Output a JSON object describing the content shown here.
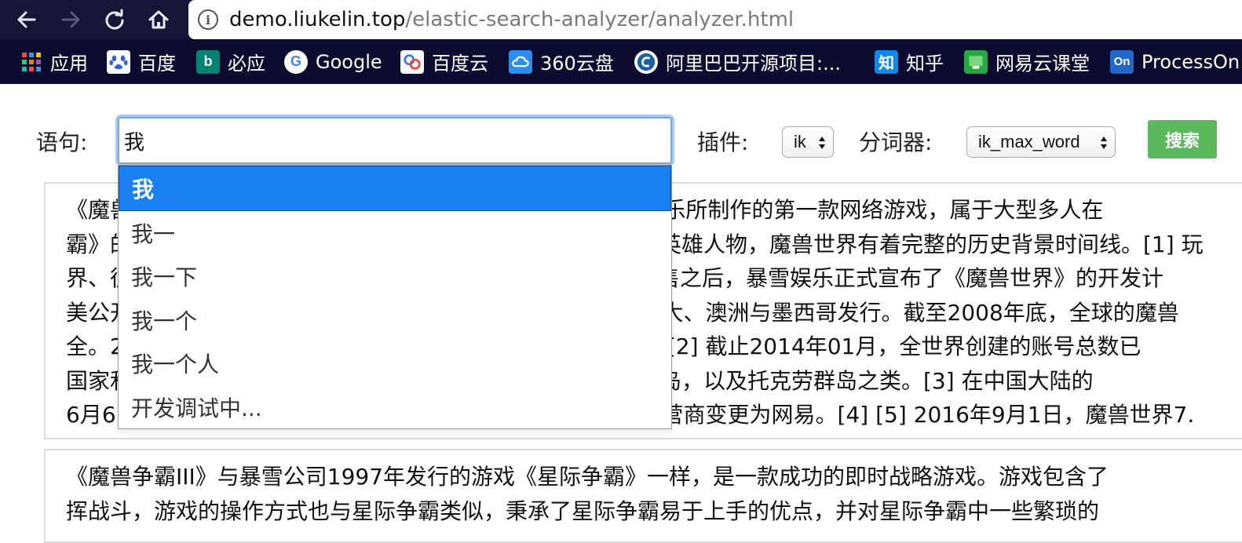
{
  "browser": {
    "url_host": "demo.liukelin.top",
    "url_path": "/elastic-search-analyzer/analyzer.html",
    "info_glyph": "i"
  },
  "bookmarks": [
    {
      "label": "应用",
      "icon": "apps-grid-icon",
      "color": "#e74c3c"
    },
    {
      "label": "百度",
      "icon": "baidu-paw-icon",
      "color": "#2c5ee8"
    },
    {
      "label": "必应",
      "icon": "bing-icon",
      "color": "#008373"
    },
    {
      "label": "Google",
      "icon": "google-icon",
      "color": "#ffffff"
    },
    {
      "label": "百度云",
      "icon": "baidu-cloud-icon",
      "color": "#3a7ef0"
    },
    {
      "label": "360云盘",
      "icon": "cloud-disk-icon",
      "color": "#2d8cf0"
    },
    {
      "label": "阿里巴巴开源项目:...",
      "icon": "alibaba-icon",
      "color": "#1a5fa8"
    },
    {
      "label": "知乎",
      "icon": "zhihu-icon",
      "color": "#0f88eb"
    },
    {
      "label": "网易云课堂",
      "icon": "netease-study-icon",
      "color": "#28a745"
    },
    {
      "label": "ProcessOn",
      "icon": "processon-icon",
      "color": "#2266c8"
    }
  ],
  "bookmark_glyphs": {
    "bing": "b",
    "google": "G",
    "zhihu": "知",
    "processon": "On"
  },
  "form": {
    "sentence_label": "语句:",
    "sentence_value": "我",
    "plugin_label": "插件:",
    "plugin_value": "ik",
    "analyzer_label": "分词器:",
    "analyzer_value": "ik_max_word",
    "search_button": "搜索"
  },
  "suggestions": [
    "我",
    "我一",
    "我一下",
    "我一个",
    "我一个人",
    "开发调试中..."
  ],
  "panels": [
    {
      "lines": [
        "《魔兽世界》（World of Warcraft）是由著名游戏公司暴雪娱乐所制作的第一款网络游戏，属于大型多人在",
        "霸》的历史背景为依托，玩家可以在游戏中遇到许多历史上的英雄人物，魔兽世界有着完整的历史背景时间线。[1] 玩",
        "界、征服世界的愿望。2001年，《魔兽争霸III：混乱之治》发售之后，暴雪娱乐正式宣布了《魔兽世界》的开发计",
        "美公开测试，2004年11月23日在北美、欧洲、新西兰、加拿大、澳洲与墨西哥发行。截至2008年底，全球的魔兽",
        "全。2008年，魔兽世界占据全球MMORPG市场份额的62%。[2] 截止2014年01月，全世界创建的账号总数已",
        "国家和地区：美国、加拿大、澳大利亚、新西兰、关岛、圣诞岛，以及托克劳群岛之类。[3] 在中国大陆的",
        "6月6日，由九城代理，2009年6月7日，魔兽世界中国大陆运营商变更为网易。[4] [5] 2016年9月1日，魔兽世界7."
      ]
    },
    {
      "lines": [
        "《魔兽争霸III》与暴雪公司1997年发行的游戏《星际争霸》一样，是一款成功的即时战略游戏。游戏包含了",
        "挥战斗，游戏的操作方式也与星际争霸类似，秉承了星际争霸易于上手的优点，并对星际争霸中一些繁琐的"
      ]
    }
  ]
}
